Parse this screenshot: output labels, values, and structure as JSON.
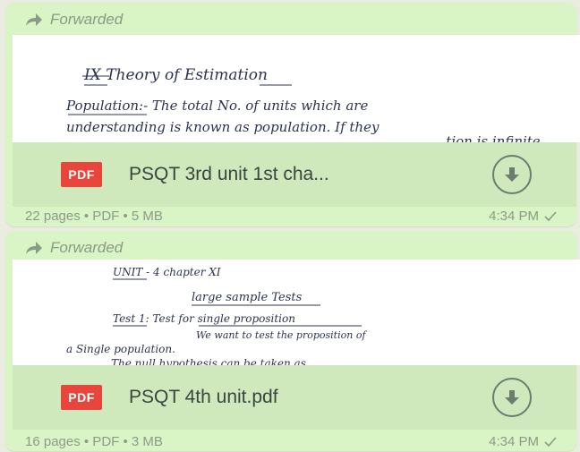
{
  "messages": [
    {
      "forwarded_label": "Forwarded",
      "preview_lines": [
        "IX   Theory   of   Estimation",
        "Population:- The total No. of units which are",
        "understanding   is known as population. If they",
        "...tion is infinite,"
      ],
      "file_type": "PDF",
      "file_name": "PSQT 3rd unit 1st cha...",
      "meta": "22 pages • PDF • 5 MB",
      "time": "4:34 PM",
      "status_icon": "check-icon",
      "download_icon": "download-icon"
    },
    {
      "forwarded_label": "Forwarded",
      "preview_lines": [
        "UNIT - 4      chapter XI",
        "large  sample  Tests",
        "Test 1:    Test for single proposition",
        "We want to test the proposition of",
        "a Single    population.",
        "The null hypothesis can be taken as"
      ],
      "file_type": "PDF",
      "file_name": "PSQT 4th unit.pdf",
      "meta": "16 pages • PDF • 3 MB",
      "time": "4:34 PM",
      "status_icon": "check-icon",
      "download_icon": "download-icon"
    }
  ],
  "colors": {
    "bubble": "#d9f4c5",
    "docbar": "#cfe9bd",
    "pdf_badge": "#e8453c",
    "meta_text": "#8d9a8a"
  }
}
